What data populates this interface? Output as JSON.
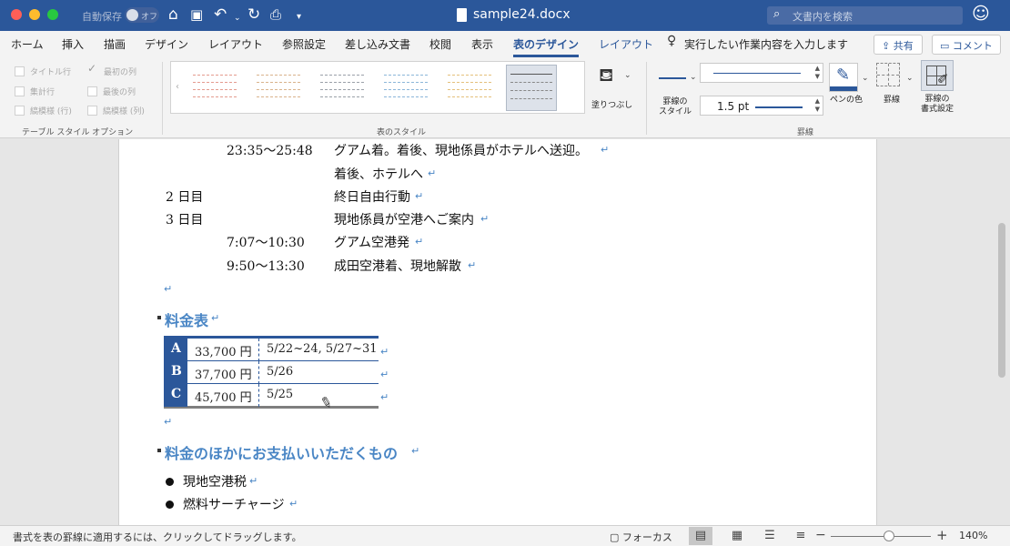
{
  "titlebar": {
    "autosave_label": "自動保存",
    "autosave_state": "オフ",
    "document_title": "sample24.docx",
    "search_placeholder": "文書内を検索"
  },
  "ribbon_tabs": [
    {
      "label": "ホーム"
    },
    {
      "label": "挿入"
    },
    {
      "label": "描画"
    },
    {
      "label": "デザイン"
    },
    {
      "label": "レイアウト"
    },
    {
      "label": "参照設定"
    },
    {
      "label": "差し込み文書"
    },
    {
      "label": "校閲"
    },
    {
      "label": "表示"
    },
    {
      "label": "表のデザイン"
    },
    {
      "label": "レイアウト"
    }
  ],
  "tell_me": "実行したい作業内容を入力します",
  "share_label": "共有",
  "comment_label": "コメント",
  "style_options": {
    "items": [
      "タイトル行",
      "最初の列",
      "集計行",
      "最後の列",
      "縞模様 (行)",
      "縞模様 (列)"
    ],
    "group_label": "テーブル スタイル オプション"
  },
  "table_styles": {
    "group_label": "表のスタイル",
    "shading_label": "塗りつぶし",
    "thumb_colors": [
      "#e49b8f",
      "#d9b38c",
      "#9aa0a8",
      "#8bb6d9",
      "#e5c07b"
    ]
  },
  "borders": {
    "border_style_label": "罫線の\nスタイル",
    "weight_value": "1.5 pt",
    "pen_color_label": "ペンの色",
    "borders_label": "罫線",
    "painter_label": "罫線の\n書式設定",
    "group_label": "罫線",
    "pen_color": "#2b579a"
  },
  "document": {
    "schedule": [
      {
        "time": "23:35～25:48",
        "text": "グアム着。着後、現地係員がホテルへ送迎。"
      },
      {
        "time": "",
        "text": "着後、ホテルへ"
      },
      {
        "day": "2 日目",
        "text": "終日自由行動"
      },
      {
        "day": "3 日目",
        "text": "現地係員が空港へご案内"
      },
      {
        "time": "7:07～10:30",
        "text": "グアム空港発"
      },
      {
        "time": "9:50～13:30",
        "text": "成田空港着、現地解散"
      }
    ],
    "price_heading": "料金表",
    "price_table": [
      {
        "label": "A",
        "price": "33,700 円",
        "dates": "5/22~24, 5/27~31"
      },
      {
        "label": "B",
        "price": "37,700 円",
        "dates": "5/26"
      },
      {
        "label": "C",
        "price": "45,700 円",
        "dates": "5/25"
      }
    ],
    "extra_heading": "料金のほかにお支払いいただくもの",
    "extra_items": [
      "現地空港税",
      "燃料サーチャージ"
    ],
    "paragraph_mark": "↵"
  },
  "statusbar": {
    "message": "書式を表の罫線に適用するには、クリックしてドラッグします。",
    "focus_label": "フォーカス",
    "zoom": "140%"
  }
}
